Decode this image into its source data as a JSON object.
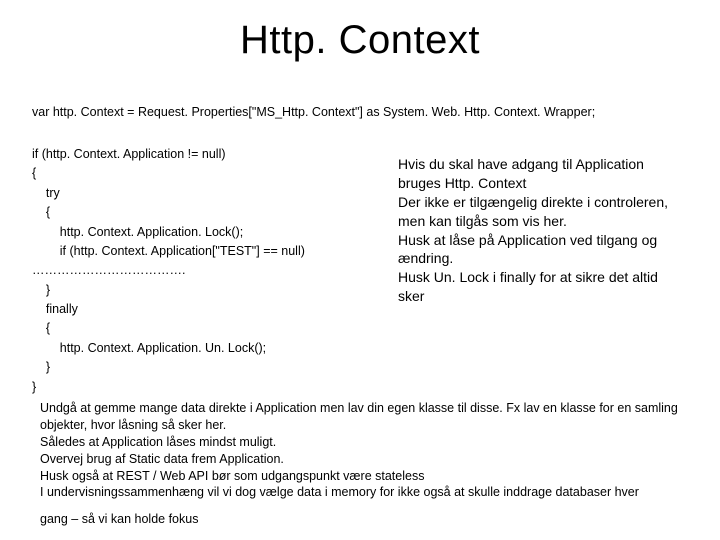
{
  "title": "Http. Context",
  "decl": "var http. Context = Request. Properties[\"MS_Http. Context\"] as System. Web. Http. Context. Wrapper;",
  "code": {
    "l1": "if (http. Context. Application != null)",
    "l2": "{",
    "l3": "    try",
    "l4": "    {",
    "l5": "        http. Context. Application. Lock();",
    "l6": "        if (http. Context. Application[\"TEST\"] == null)",
    "l7": "……………………………….",
    "l8": "    }",
    "l9": "    finally",
    "l10": "    {",
    "l11": "        http. Context. Application. Un. Lock();",
    "l12": "    }",
    "l13": "}"
  },
  "side": {
    "p1": "Hvis du skal have adgang til Application bruges Http. Context",
    "p2": "Der ikke er tilgængelig direkte i controleren, men kan tilgås som vis her.",
    "p3": "Husk at låse på Application ved tilgang og ændring.",
    "p4": "Husk Un. Lock i finally for at sikre det altid sker"
  },
  "bottom": {
    "p1": "Undgå at gemme mange data direkte i Application men lav din egen klasse til disse. Fx lav en klasse for en samling objekter, hvor låsning så sker her.",
    "p2": "Således at Application låses mindst muligt.",
    "p3": "Overvej brug af Static data frem Application.",
    "p4": "Husk også at REST / Web API bør som udgangspunkt være stateless",
    "p5": "I undervisningssammenhæng vil vi dog vælge data i memory for ikke også at skulle inddrage databaser hver",
    "p6": "gang – så vi kan holde fokus"
  }
}
